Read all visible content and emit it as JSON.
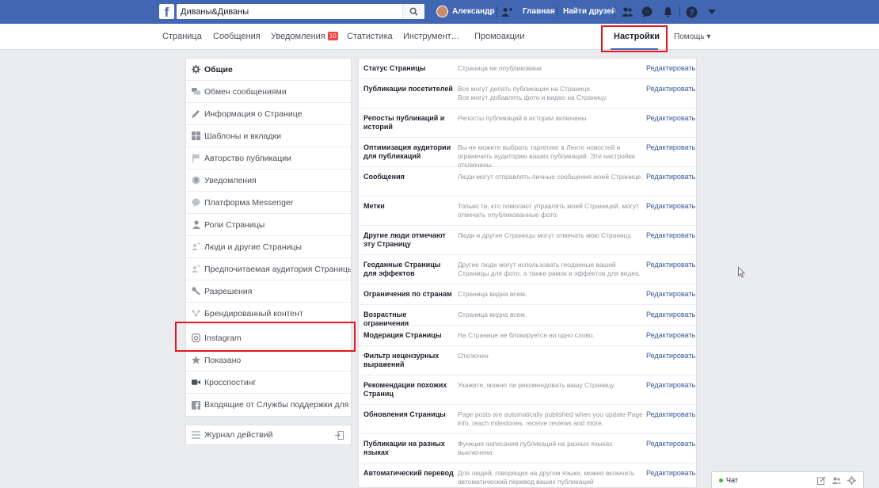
{
  "topbar": {
    "search_value": "Диваны&Диваны",
    "user_name": "Александр",
    "home_label": "Главная",
    "find_friends_label": "Найти друзей"
  },
  "subnav": {
    "items": [
      "Страница",
      "Сообщения",
      "Уведомления",
      "Статистика",
      "Инструмент…",
      "Промоакции"
    ],
    "notifications_badge": "10",
    "settings_label": "Настройки",
    "help_label": "Помощь ▾"
  },
  "sidebar": {
    "items": [
      {
        "label": "Общие",
        "icon": "gear-icon"
      },
      {
        "label": "Обмен сообщениями",
        "icon": "chat-icon"
      },
      {
        "label": "Информация о Странице",
        "icon": "pencil-icon"
      },
      {
        "label": "Шаблоны и вкладки",
        "icon": "grid-icon"
      },
      {
        "label": "Авторство публикации",
        "icon": "flag-icon"
      },
      {
        "label": "Уведомления",
        "icon": "globe-icon"
      },
      {
        "label": "Платформа Messenger",
        "icon": "messenger-icon"
      },
      {
        "label": "Роли Страницы",
        "icon": "person-icon"
      },
      {
        "label": "Люди и другие Страницы",
        "icon": "people-icon"
      },
      {
        "label": "Предпочитаемая аудитория Страницы",
        "icon": "audience-icon"
      },
      {
        "label": "Разрешения",
        "icon": "wrench-icon"
      },
      {
        "label": "Брендированный контент",
        "icon": "branded-icon"
      },
      {
        "label": "Instagram",
        "icon": "instagram-icon"
      },
      {
        "label": "Показано",
        "icon": "star-icon"
      },
      {
        "label": "Кросспостинг",
        "icon": "video-icon"
      },
      {
        "label": "Входящие от Службы поддержки для Стр",
        "icon": "facebook-icon"
      }
    ],
    "activity_log": "Журнал действий"
  },
  "settings_rows": [
    {
      "name": "Статус Страницы",
      "desc": "Страница не опубликована",
      "edit": "Редактировать"
    },
    {
      "name": "Публикации посетителей",
      "desc": "Все могут делать публикации на Странице.\nВсе могут добавлять фото и видео на Страницу.",
      "edit": "Редактировать"
    },
    {
      "name": "Репосты публикаций и историй",
      "desc": "Репосты публикаций в истории включены",
      "edit": "Редактировать"
    },
    {
      "name": "Оптимизация аудитории для публикаций",
      "desc": "Вы не можете выбрать таргетинг в Ленте новостей и ограничить аудиторию ваших публикаций. Эти настройки отключены",
      "edit": "Редактировать"
    },
    {
      "name": "Сообщения",
      "desc": "Люди могут отправлять личные сообщения моей Странице.",
      "edit": "Редактировать"
    },
    {
      "name": "Метки",
      "desc": "Только те, кто помогают управлять моей Страницей, могут отмечать опубликованные фото.",
      "edit": "Редактировать"
    },
    {
      "name": "Другие люди отмечают эту Страницу",
      "desc": "Люди и другие Страницы могут отмечать мою Страницу.",
      "edit": "Редактировать"
    },
    {
      "name": "Геоданные Страницы для эффектов",
      "desc": "Другие люди могут использовать геоданные вашей Страницы для фото, а также рамок и эффектов для видео.",
      "edit": "Редактировать"
    },
    {
      "name": "Ограничения по странам",
      "desc": "Страница видна всем.",
      "edit": "Редактировать"
    },
    {
      "name": "Возрастные ограничения",
      "desc": "Страница видна всем.",
      "edit": "Редактировать"
    },
    {
      "name": "Модерация Страницы",
      "desc": "На Странице не блокируется ни одно слово.",
      "edit": "Редактировать"
    },
    {
      "name": "Фильтр нецензурных выражений",
      "desc": "Отключен",
      "edit": "Редактировать"
    },
    {
      "name": "Рекомендации похожих Страниц",
      "desc": "Укажите, можно ли рекомендовать вашу Страницу",
      "edit": "Редактировать"
    },
    {
      "name": "Обновления Страницы",
      "desc": "Page posts are automatically published when you update Page info, reach milestones, receive reviews and more.",
      "edit": "Редактировать"
    },
    {
      "name": "Публикации на разных языках",
      "desc": "Функция написания публикаций на разных языках выключена",
      "edit": "Редактировать"
    },
    {
      "name": "Автоматический перевод",
      "desc": "Для людей, говорящих на другом языке, можно включить автоматический перевод ваших публикаций",
      "edit": "Редактировать"
    }
  ],
  "chat": {
    "label": "Чат"
  }
}
